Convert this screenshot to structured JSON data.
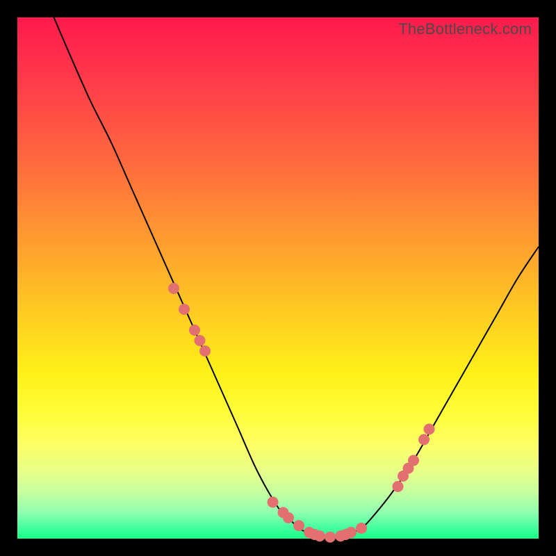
{
  "watermark": "TheBottleneck.com",
  "chart_data": {
    "type": "line",
    "title": "",
    "xlabel": "",
    "ylabel": "",
    "xlim": [
      0,
      100
    ],
    "ylim": [
      0,
      100
    ],
    "background_gradient": {
      "top": "#ff1a4d",
      "middle": "#fff018",
      "bottom": "#17ff88"
    },
    "series": [
      {
        "name": "bottleneck-curve",
        "x": [
          7,
          10,
          14,
          18,
          22,
          26,
          30,
          34,
          38,
          42,
          46,
          50,
          52,
          54,
          56,
          58,
          60,
          62,
          64,
          66,
          68,
          72,
          76,
          80,
          84,
          88,
          92,
          96,
          100
        ],
        "y": [
          100,
          93,
          84,
          76,
          67,
          58,
          49,
          40,
          31,
          22,
          13,
          6,
          4,
          2,
          1,
          0,
          0,
          0,
          1,
          2,
          4,
          9,
          15,
          22,
          29,
          36,
          43,
          50,
          56
        ]
      }
    ],
    "markers": {
      "name": "highlight-points",
      "color": "#e27070",
      "x": [
        30,
        32,
        34,
        35,
        36,
        49,
        51,
        52,
        54,
        56,
        57,
        58,
        60,
        62,
        63,
        64,
        66,
        73,
        74,
        75,
        76,
        78,
        79
      ],
      "y": [
        48,
        44,
        40,
        38,
        36,
        7,
        5,
        4,
        2.5,
        1.2,
        0.8,
        0.5,
        0.3,
        0.5,
        0.8,
        1.2,
        2,
        10,
        12,
        13.5,
        15,
        19,
        21
      ]
    }
  }
}
